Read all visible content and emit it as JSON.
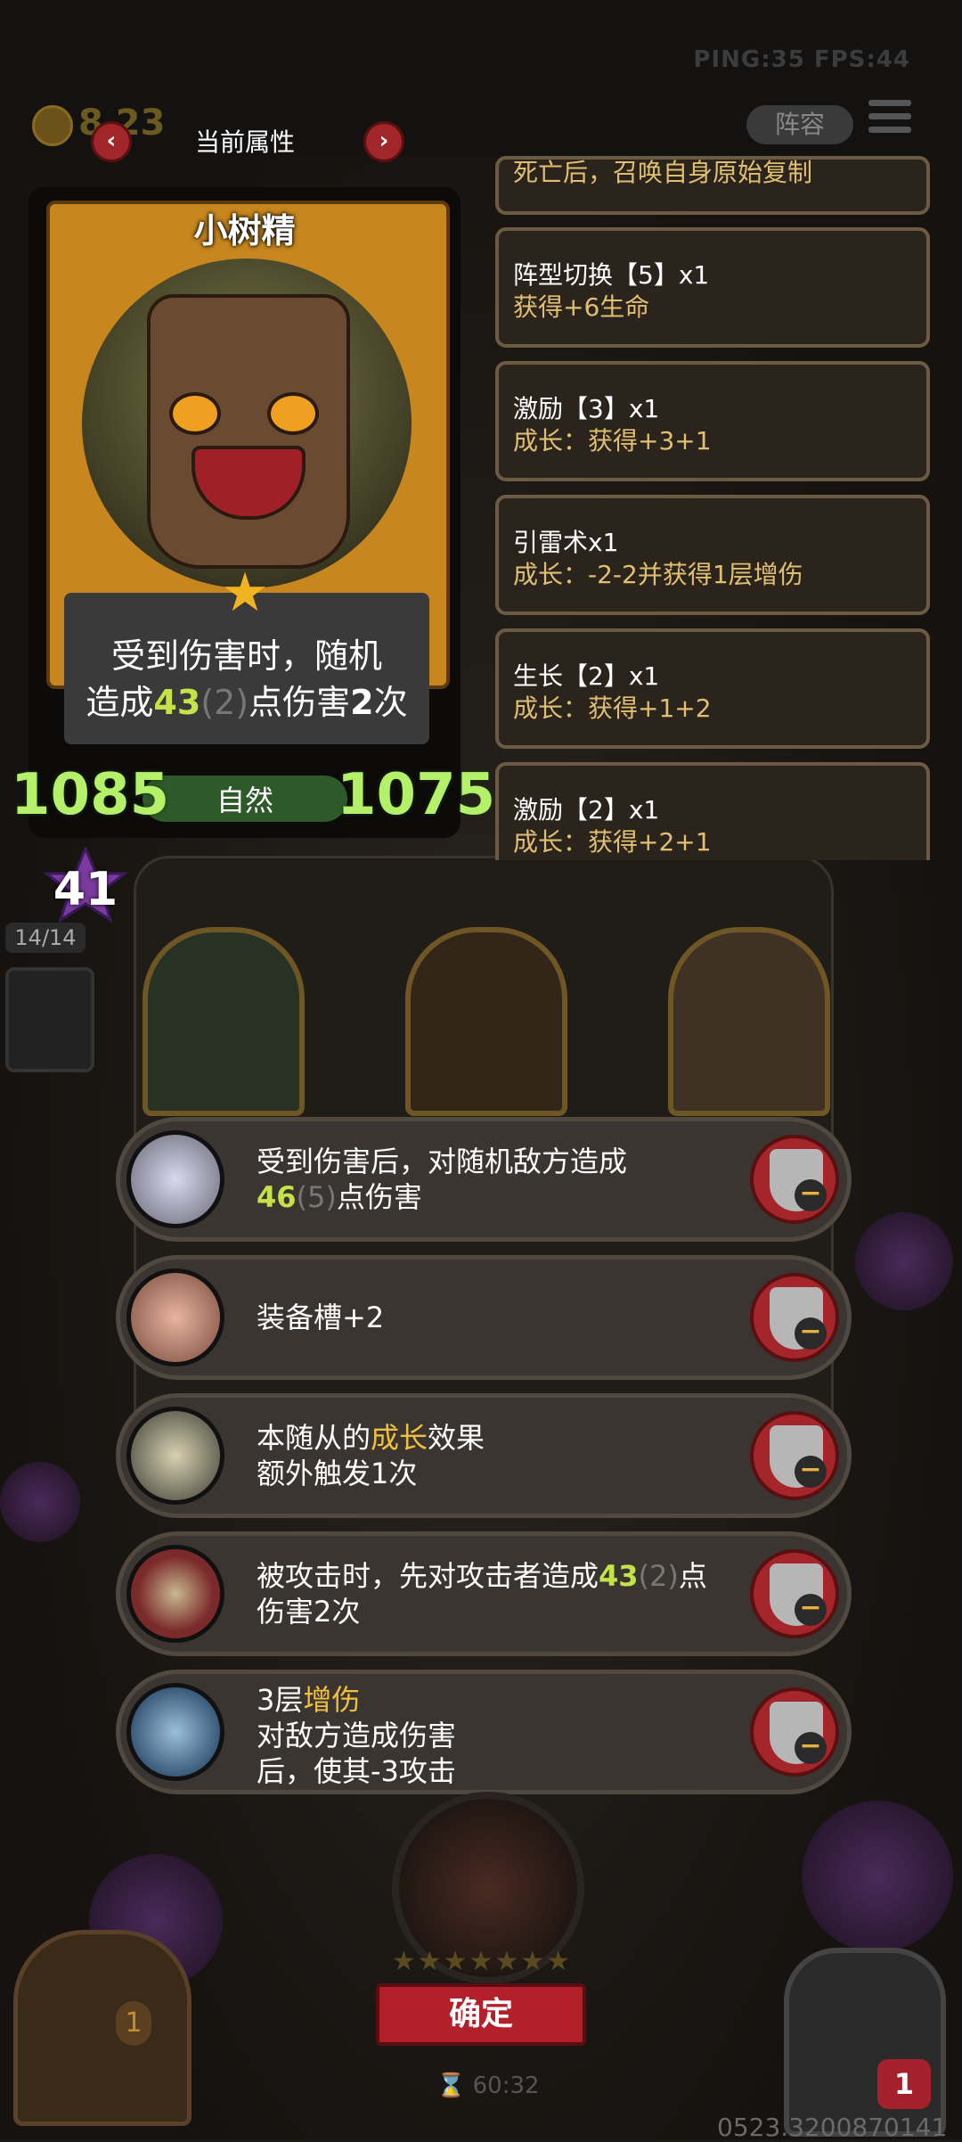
{
  "top_bar": {
    "stats": "PING:35   FPS:44",
    "gold": "8",
    "gold_suffix": "23",
    "lineup_label": "阵容"
  },
  "nav": {
    "title": "当前属性",
    "prev": "‹",
    "next": "›"
  },
  "card": {
    "name": "小树精",
    "desc_line1": "受到伤害时，随机",
    "desc_prefix": "造成",
    "desc_value": "43",
    "desc_bonus": "(2)",
    "desc_mid": "点伤害",
    "desc_times": "2",
    "desc_suffix": "次",
    "attack": "1085",
    "health": "1075",
    "type": "自然",
    "level": "41",
    "slots": "14/14"
  },
  "effects": [
    {
      "line1": "",
      "line2": "死亡后，召唤自身原始复制"
    },
    {
      "line1": "阵型切换【5】x1",
      "line2": "获得+6生命"
    },
    {
      "line1": "激励【3】x1",
      "line2": "成长：获得+3+1"
    },
    {
      "line1": "引雷术x1",
      "line2": "成长：-2-2并获得1层增伤"
    },
    {
      "line1": "生长【2】x1",
      "line2": "成长：获得+1+2"
    },
    {
      "line1": "激励【2】x1",
      "line2": "成长：获得+2+1"
    }
  ],
  "bonuses": [
    {
      "l1": "受到伤害后，对随机敌方造成",
      "l2_val": "46",
      "l2_dim": "(5)",
      "l2_rest": "点伤害",
      "icon": "crystal-icon"
    },
    {
      "l1": "装备槽+2",
      "icon": "pig-icon"
    },
    {
      "l1_a": "本随从的",
      "l1_hl": "成长",
      "l1_b": "效果",
      "l2": "额外触发1次",
      "icon": "gauntlet-icon"
    },
    {
      "l1_a": "被攻击时，先对攻击者造成",
      "l1_val": "43",
      "l1_dim": "(2)",
      "l1_b": "点",
      "l2": "伤害2次",
      "icon": "cloak-icon"
    },
    {
      "l1_a": "3层",
      "l1_hl": "增伤",
      "l2": "对敌方造成伤害",
      "l3": "后，使其-3攻击",
      "icon": "book-icon"
    }
  ],
  "bottom": {
    "stars": "★★★★★★★",
    "confirm": "确定",
    "timer": "⌛ 60:32",
    "version": "0523.3200870141",
    "heart_count": "1",
    "chest_count": "1"
  },
  "colors": {
    "accent_red": "#a4262a",
    "stat_green": "#b4f06a",
    "highlight_yellow": "#f0c040"
  }
}
